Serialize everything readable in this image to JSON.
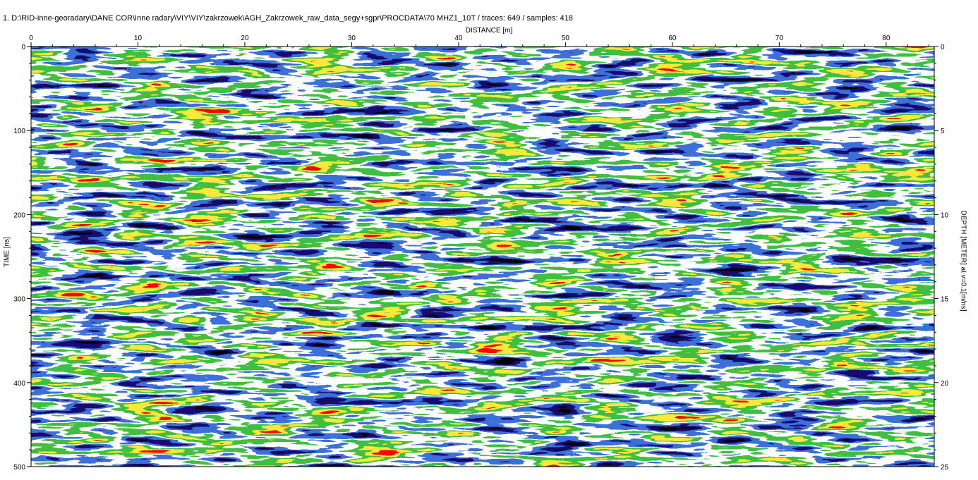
{
  "header": {
    "file_title": "1. D:\\RID-inne-georadary\\DANE COR\\Inne radary\\VIY\\VIY\\zakrzowek\\AGH_Zakrzowek_raw_data_segy+sgpr\\PROCDATA\\70 MHZ1_10T / traces: 649 / samples: 418"
  },
  "chart_data": {
    "type": "heatmap",
    "title": "",
    "xlabel": "DISTANCE [m]",
    "ylabel_left": "TIME [ns]",
    "ylabel_right": "DEPTH [METER] at v=0.1[m/ns]",
    "x_ticks": [
      0,
      10,
      20,
      30,
      40,
      50,
      60,
      70,
      80
    ],
    "x_range": [
      0,
      84.5
    ],
    "time_ticks": [
      0,
      100,
      200,
      300,
      400,
      500
    ],
    "time_range": [
      0,
      500
    ],
    "depth_ticks": [
      0,
      5,
      10,
      15,
      20,
      25
    ],
    "depth_range": [
      0,
      25
    ],
    "traces": 649,
    "samples": 418,
    "colormap": [
      "#000000",
      "#1a0a6e",
      "#3a6fd8",
      "#ffffff",
      "#3fbf3f",
      "#ffe83a",
      "#ff0000"
    ],
    "grid": false,
    "legend": "none"
  }
}
